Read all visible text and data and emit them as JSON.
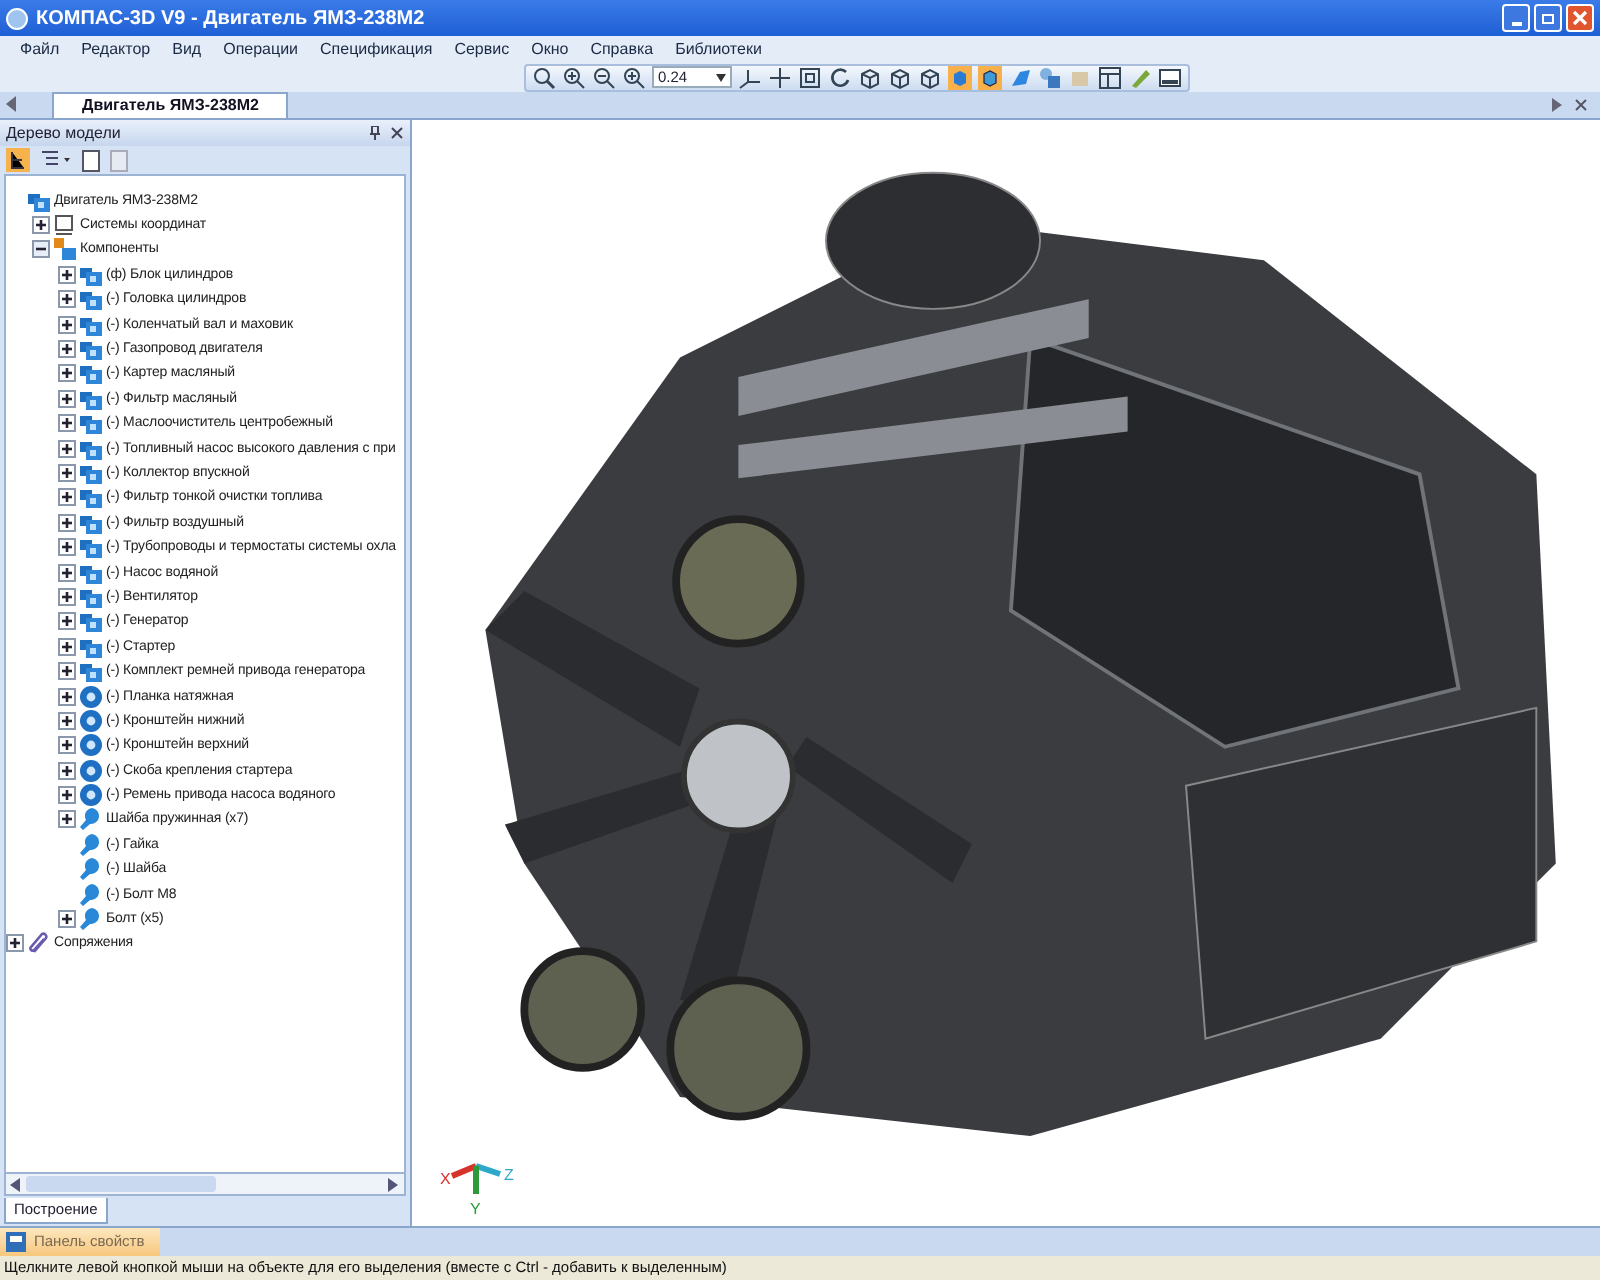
{
  "window": {
    "title": "КОМПАС-3D V9 - Двигатель ЯМЗ-238М2"
  },
  "menu": [
    "Файл",
    "Редактор",
    "Вид",
    "Операции",
    "Спецификация",
    "Сервис",
    "Окно",
    "Справка",
    "Библиотеки"
  ],
  "toolbar": {
    "zoom_value": "0.24"
  },
  "document_tabs": [
    {
      "label": "Двигатель ЯМЗ-238М2",
      "selected": true
    }
  ],
  "model_tree": {
    "title": "Дерево модели",
    "items": [
      {
        "label": "Двигатель ЯМЗ-238М2",
        "kind": "assembly",
        "expandable": false,
        "expanded": true,
        "children": [
          {
            "label": "Системы координат",
            "kind": "coordinates",
            "expandable": true,
            "expanded": false
          },
          {
            "label": "Компоненты",
            "kind": "components",
            "expandable": true,
            "expanded": true,
            "children": [
              {
                "label": "(ф) Блок цилиндров",
                "kind": "assembly",
                "expandable": true,
                "expanded": false
              },
              {
                "label": "(-) Головка цилиндров",
                "kind": "assembly",
                "expandable": true,
                "expanded": false
              },
              {
                "label": "(-) Коленчатый вал и маховик",
                "kind": "assembly",
                "expandable": true,
                "expanded": false
              },
              {
                "label": "(-) Газопровод двигателя",
                "kind": "assembly",
                "expandable": true,
                "expanded": false
              },
              {
                "label": "(-) Картер масляный",
                "kind": "assembly",
                "expandable": true,
                "expanded": false
              },
              {
                "label": "(-) Фильтр масляный",
                "kind": "assembly",
                "expandable": true,
                "expanded": false
              },
              {
                "label": "(-) Маслоочиститель центробежный",
                "kind": "assembly",
                "expandable": true,
                "expanded": false
              },
              {
                "label": "(-) Топливный насос высокого давления с при",
                "kind": "assembly",
                "expandable": true,
                "expanded": false
              },
              {
                "label": "(-) Коллектор впускной",
                "kind": "assembly",
                "expandable": true,
                "expanded": false
              },
              {
                "label": "(-) Фильтр тонкой очистки топлива",
                "kind": "assembly",
                "expandable": true,
                "expanded": false
              },
              {
                "label": "(-) Фильтр воздушный",
                "kind": "assembly",
                "expandable": true,
                "expanded": false
              },
              {
                "label": "(-) Трубопроводы и термостаты системы охла",
                "kind": "assembly",
                "expandable": true,
                "expanded": false
              },
              {
                "label": "(-) Насос водяной",
                "kind": "assembly",
                "expandable": true,
                "expanded": false
              },
              {
                "label": "(-) Вентилятор",
                "kind": "assembly",
                "expandable": true,
                "expanded": false
              },
              {
                "label": "(-) Генератор",
                "kind": "assembly",
                "expandable": true,
                "expanded": false
              },
              {
                "label": "(-) Стартер",
                "kind": "assembly",
                "expandable": true,
                "expanded": false
              },
              {
                "label": "(-) Комплект ремней привода генератора",
                "kind": "assembly",
                "expandable": true,
                "expanded": false
              },
              {
                "label": "(-) Планка натяжная",
                "kind": "part",
                "expandable": true,
                "expanded": false
              },
              {
                "label": "(-) Кронштейн нижний",
                "kind": "part",
                "expandable": true,
                "expanded": false
              },
              {
                "label": "(-) Кронштейн верхний",
                "kind": "part",
                "expandable": true,
                "expanded": false
              },
              {
                "label": "(-) Скоба крепления стартера",
                "kind": "part",
                "expandable": true,
                "expanded": false
              },
              {
                "label": "(-) Ремень привода насоса водяного",
                "kind": "part",
                "expandable": true,
                "expanded": false
              },
              {
                "label": "Шайба пружинная (x7)",
                "kind": "standard",
                "expandable": true,
                "expanded": false
              },
              {
                "label": "(-) Гайка",
                "kind": "standard",
                "expandable": false,
                "expanded": false
              },
              {
                "label": "(-) Шайба",
                "kind": "standard",
                "expandable": false,
                "expanded": false
              },
              {
                "label": "(-) Болт М8",
                "kind": "standard",
                "expandable": false,
                "expanded": false
              },
              {
                "label": "Болт (x5)",
                "kind": "standard",
                "expandable": true,
                "expanded": false
              }
            ]
          }
        ]
      },
      {
        "label": "Сопряжения",
        "kind": "constraints",
        "expandable": true,
        "expanded": false
      }
    ]
  },
  "panel_tabs": [
    {
      "label": "Построение",
      "selected": true
    }
  ],
  "viewport": {
    "axis_labels": [
      "X",
      "Y",
      "Z"
    ]
  },
  "properties_panel": {
    "label": "Панель свойств"
  },
  "status_bar": {
    "text": "Щелкните левой кнопкой мыши на объекте для его выделения (вместе с Ctrl - добавить к выделенным)"
  }
}
